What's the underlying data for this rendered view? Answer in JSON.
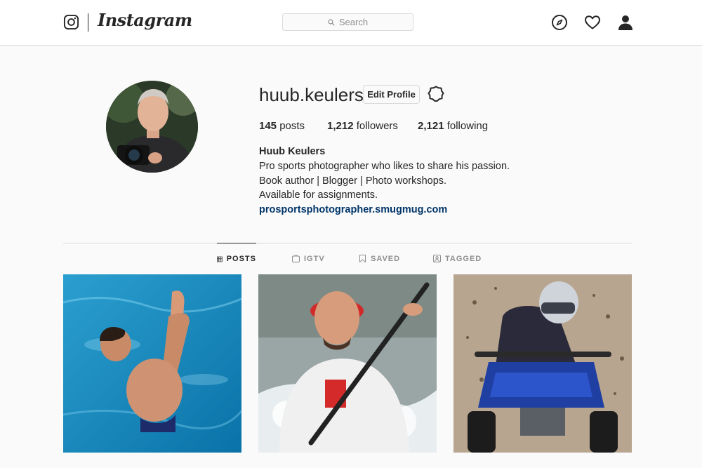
{
  "header": {
    "brand": "Instagram",
    "search": {
      "placeholder": "Search"
    },
    "icons": [
      "instagram-logo-icon",
      "compass-icon",
      "heart-icon",
      "profile-icon"
    ]
  },
  "profile": {
    "username": "huub.keulers",
    "edit_label": "Edit Profile",
    "stats": {
      "posts_count": "145",
      "posts_label": "posts",
      "followers_count": "1,212",
      "followers_label": "followers",
      "following_count": "2,121",
      "following_label": "following"
    },
    "full_name": "Huub Keulers",
    "bio_lines": [
      "Pro sports photographer who likes to share his passion.",
      "Book author | Blogger | Photo workshops.",
      "Available for assignments."
    ],
    "website": "prosportsphotographer.smugmug.com"
  },
  "tabs": [
    {
      "label": "POSTS",
      "active": true
    },
    {
      "label": "IGTV",
      "active": false
    },
    {
      "label": "SAVED",
      "active": false
    },
    {
      "label": "TAGGED",
      "active": false
    }
  ],
  "posts": [
    {
      "subject": "diver in swimming pool"
    },
    {
      "subject": "canoe slalom athlete paddling"
    },
    {
      "subject": "quad bike rider on dirt track"
    }
  ],
  "colors": {
    "link": "#003569",
    "border": "#dbdbdb",
    "text": "#262626",
    "muted": "#8e8e8e",
    "background": "#fafafa"
  }
}
